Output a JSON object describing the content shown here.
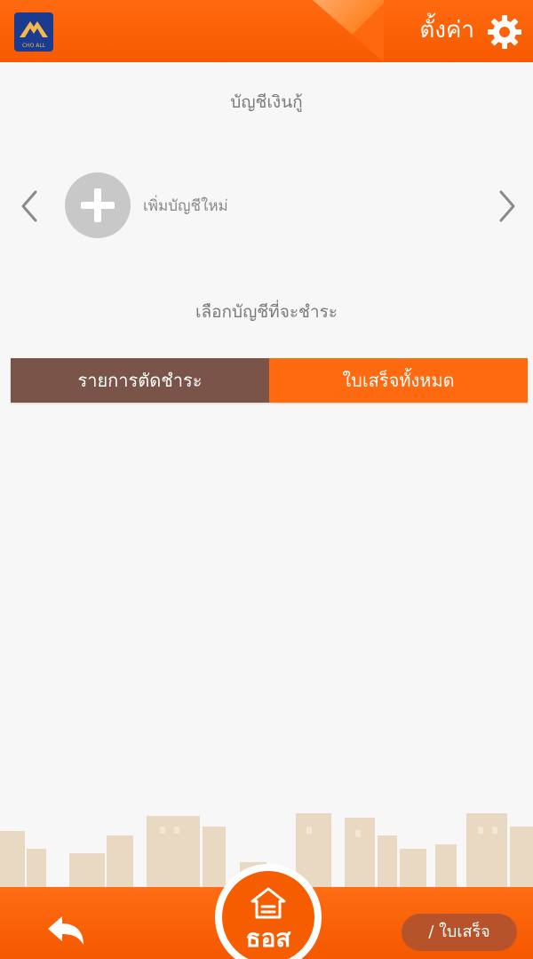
{
  "header": {
    "logo_text": "CHO ALL",
    "settings_label": "ตั้งค่า"
  },
  "loan_section": {
    "title": "บัญชีเงินกู้",
    "add_account_label": "เพิ่มบัญชีใหม่"
  },
  "payment_section": {
    "title": "เลือกบัญชีที่จะชำระ"
  },
  "tabs": [
    {
      "label": "รายการตัดชำระ"
    },
    {
      "label": "ใบเสร็จทั้งหมด"
    }
  ],
  "bottom": {
    "center_label": "ธอส",
    "receipt_label": "/ ใบเสร็จ"
  },
  "colors": {
    "brand_orange": "#ff6a10",
    "tab_active": "#7a5449"
  }
}
